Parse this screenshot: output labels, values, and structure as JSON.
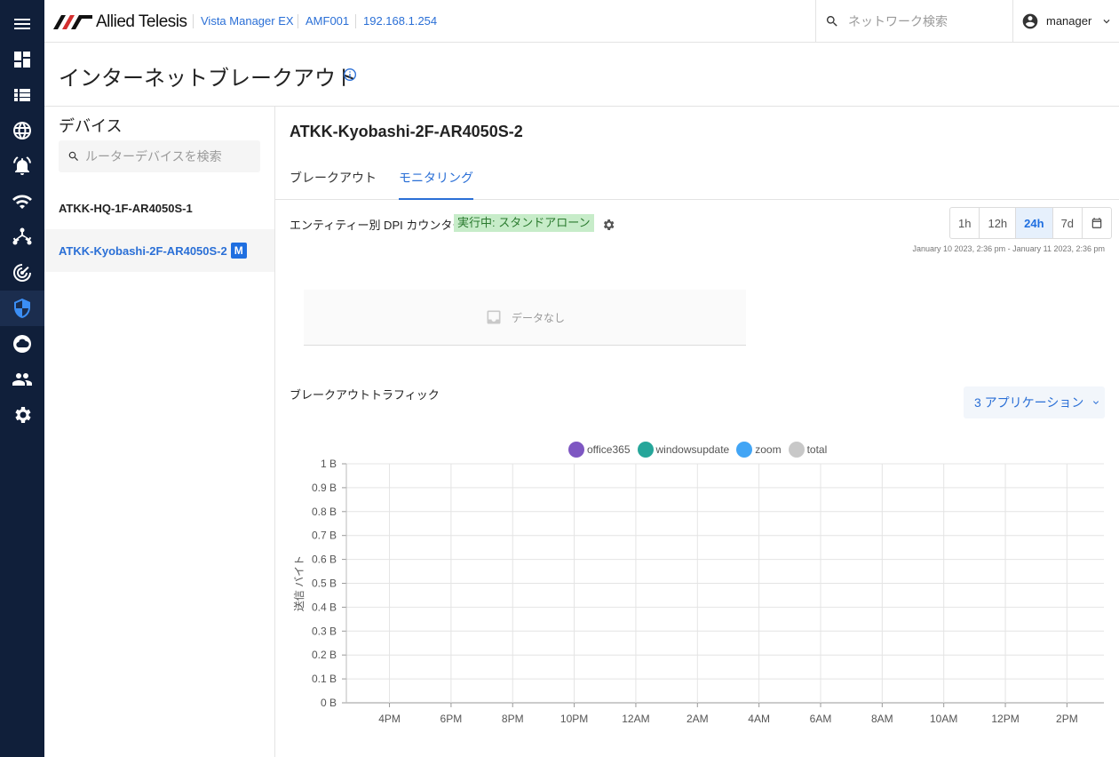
{
  "header": {
    "brand": "Allied Telesis",
    "crumbs": [
      "Vista Manager EX",
      "AMF001",
      "192.168.1.254"
    ],
    "search_placeholder": "ネットワーク検索",
    "user": "manager"
  },
  "rail": {
    "items": [
      "menu-icon",
      "dashboard-icon",
      "list-icon",
      "globe-icon",
      "alarm-icon",
      "wifi-icon",
      "topology-icon",
      "radar-icon",
      "shield-icon",
      "cloud-icon",
      "users-icon",
      "settings-icon"
    ],
    "active": "shield-icon"
  },
  "page": {
    "title": "インターネットブレークアウト"
  },
  "devices": {
    "title": "デバイス",
    "search_placeholder": "ルーターデバイスを検索",
    "items": [
      {
        "name": "ATKK-HQ-1F-AR4050S-1"
      },
      {
        "name": "ATKK-Kyobashi-2F-AR4050S-2",
        "badge": "M"
      }
    ]
  },
  "main": {
    "device_name": "ATKK-Kyobashi-2F-AR4050S-2",
    "tabs": [
      "ブレークアウト",
      "モニタリング"
    ],
    "active_tab": 1,
    "dpi_label": "エンティティー別 DPI カウンター",
    "status_chip": "実行中: スタンドアローン",
    "ranges": [
      "1h",
      "12h",
      "24h",
      "7d"
    ],
    "active_range": "24h",
    "range_caption": "January 10 2023, 2:36 pm - January 11 2023, 2:36 pm",
    "no_data": "データなし",
    "traffic_label": "ブレークアウトトラフィック",
    "app_select": "3 アプリケーション"
  },
  "colors": {
    "office365": "#7e57c2",
    "windowsupdate": "#26a69a",
    "zoom": "#42a5f5",
    "total": "#c8c8c8",
    "accent": "#2a6fd6",
    "rail_bg": "#101f3a"
  },
  "chart_data": {
    "type": "line",
    "title": "",
    "xlabel": "",
    "ylabel": "送信 バイト",
    "categories": [
      "4PM",
      "6PM",
      "8PM",
      "10PM",
      "12AM",
      "2AM",
      "4AM",
      "6AM",
      "8AM",
      "10AM",
      "12PM",
      "2PM"
    ],
    "y_ticks": [
      "0 B",
      "0.1 B",
      "0.2 B",
      "0.3 B",
      "0.4 B",
      "0.5 B",
      "0.6 B",
      "0.7 B",
      "0.8 B",
      "0.9 B",
      "1 B"
    ],
    "ylim": [
      0,
      1
    ],
    "grid": true,
    "legend_position": "top",
    "series": [
      {
        "name": "office365",
        "values": []
      },
      {
        "name": "windowsupdate",
        "values": []
      },
      {
        "name": "zoom",
        "values": []
      },
      {
        "name": "total",
        "values": []
      }
    ]
  }
}
